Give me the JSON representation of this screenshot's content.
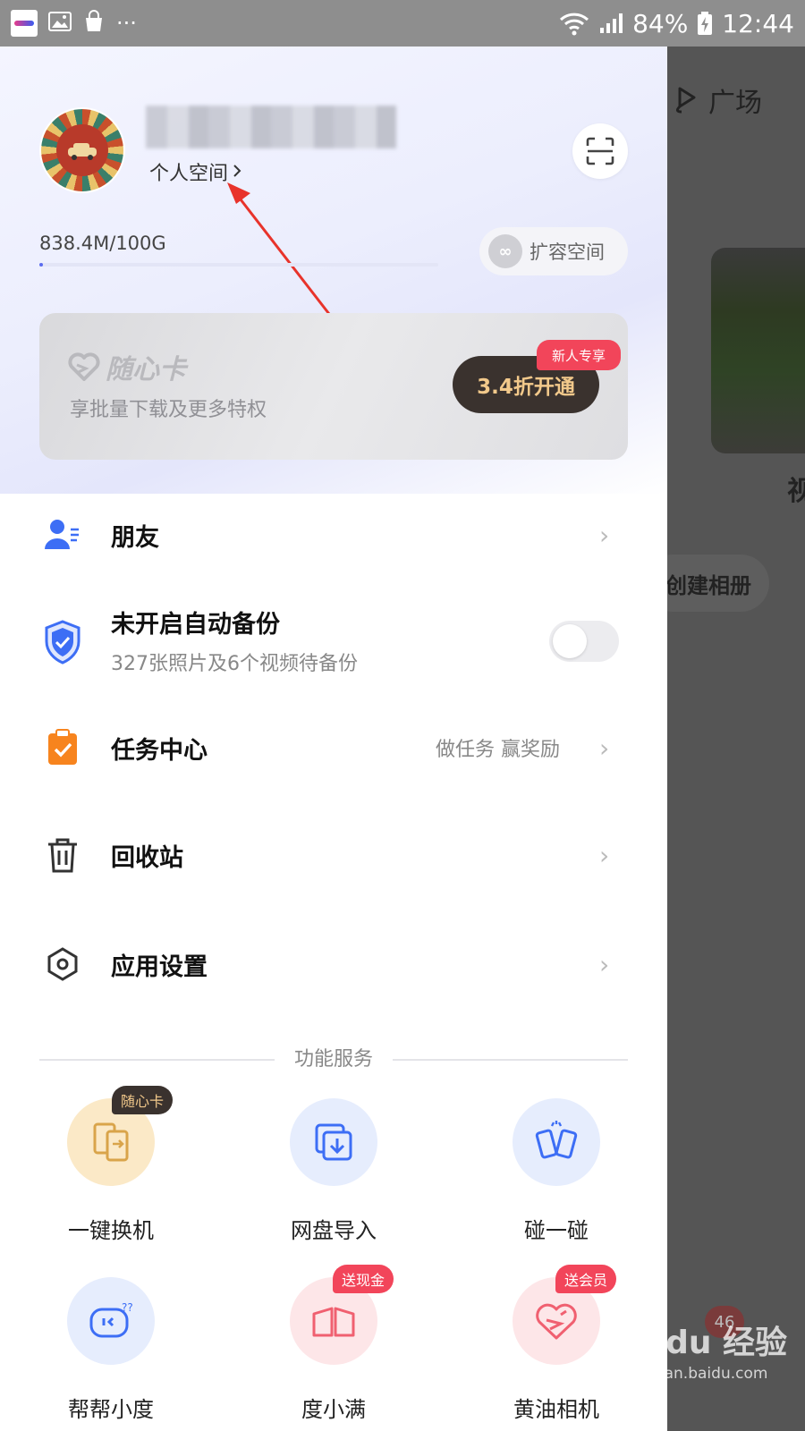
{
  "status_bar": {
    "battery": "84%",
    "time": "12:44",
    "more": "···"
  },
  "background": {
    "plaza_label": "广场",
    "partial_char": "视",
    "create_album": "创建相册",
    "badge_count": "46"
  },
  "watermark": {
    "brand": "Baidu 经验",
    "url": "jingyan.baidu.com"
  },
  "profile": {
    "personal_space": "个人空间",
    "storage": "838.4M/100G",
    "storage_used_fraction": 0.008,
    "expand_label": "扩容空间"
  },
  "vip_card": {
    "title": "随心卡",
    "subtitle": "享批量下载及更多特权",
    "button": "3.4折开通",
    "tag": "新人专享"
  },
  "menu": {
    "friends": "朋友",
    "backup_title": "未开启自动备份",
    "backup_sub": "327张照片及6个视频待备份",
    "tasks": "任务中心",
    "tasks_hint": "做任务 赢奖励",
    "recycle": "回收站",
    "settings": "应用设置"
  },
  "services": {
    "heading": "功能服务",
    "items": [
      {
        "label": "一键换机",
        "badge": "随心卡"
      },
      {
        "label": "网盘导入",
        "badge": ""
      },
      {
        "label": "碰一碰",
        "badge": ""
      },
      {
        "label": "帮帮小度",
        "badge": ""
      },
      {
        "label": "度小满",
        "badge": "送现金"
      },
      {
        "label": "黄油相机",
        "badge": "送会员"
      }
    ]
  },
  "colors": {
    "accent_blue": "#3d6ef5",
    "badge_red": "#f2455a",
    "vip_button": "#3a322e"
  }
}
